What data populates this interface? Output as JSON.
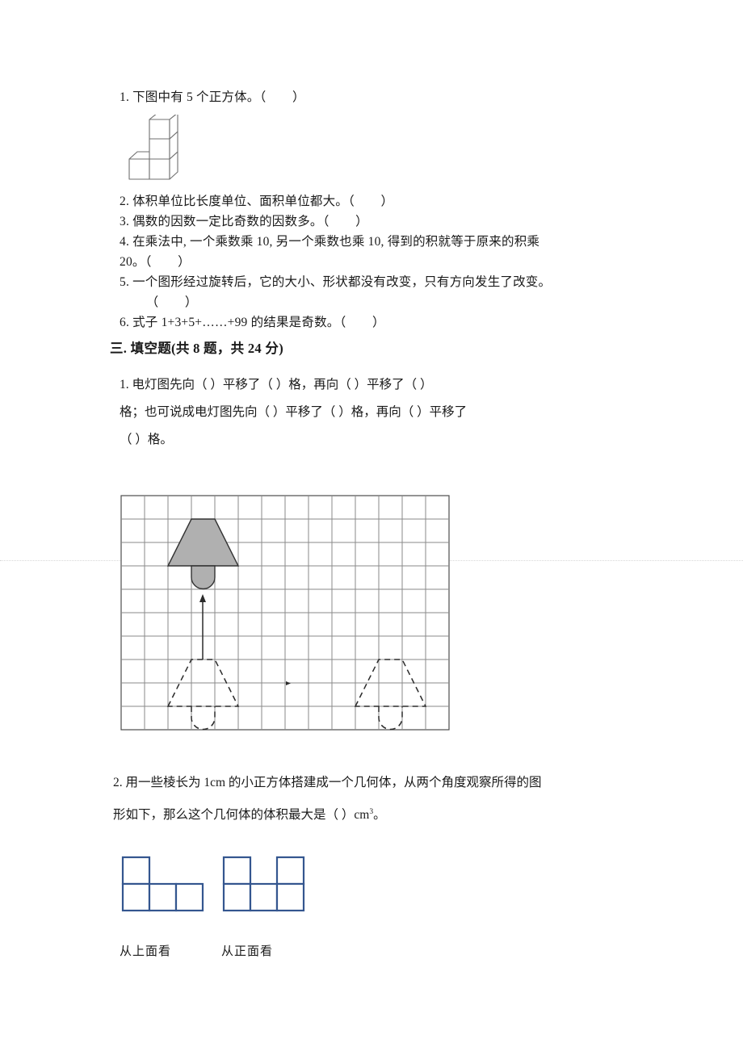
{
  "truefalse": {
    "items": [
      "1. 下图中有 5 个正方体。（        ）",
      "2. 体积单位比长度单位、面积单位都大。（        ）",
      "3. 偶数的因数一定比奇数的因数多。（        ）",
      "4. 在乘法中, 一个乘数乘 10, 另一个乘数也乘 10, 得到的积就等于原来的积乘",
      "20。（        ）",
      "5. 一个图形经过旋转后，它的大小、形状都没有改变，只有方向发生了改变。",
      "        （        ）",
      "6. 式子 1+3+5+……+99 的结果是奇数。（        ）"
    ]
  },
  "section": {
    "heading": "三. 填空题(共 8 题，共 24 分)"
  },
  "fill_in": {
    "q1_line1": "1. 电灯图先向（         ）平移了（         ）格，再向（         ）平移了（         ）",
    "q1_line2": "格；也可说成电灯图先向（         ）平移了（         ）格，再向（         ）平移了",
    "q1_line3": "（         ）格。",
    "q2_line1": "2. 用一些棱长为 1cm 的小正方体搭建成一个几何体，从两个角度观察所得的图",
    "q2_line2a": "形如下，那么这个几何体的体积最大是（         ）cm",
    "q2_sup": "3",
    "q2_line2b": "。"
  },
  "views": {
    "top_label": "从上面看",
    "front_label": "从正面看",
    "stroke_color": "#34568f"
  },
  "grid": {
    "cols": 14,
    "rows": 10,
    "cell": 29,
    "line_color": "#4d4d4d",
    "shade_color": "#b3b3b3"
  }
}
